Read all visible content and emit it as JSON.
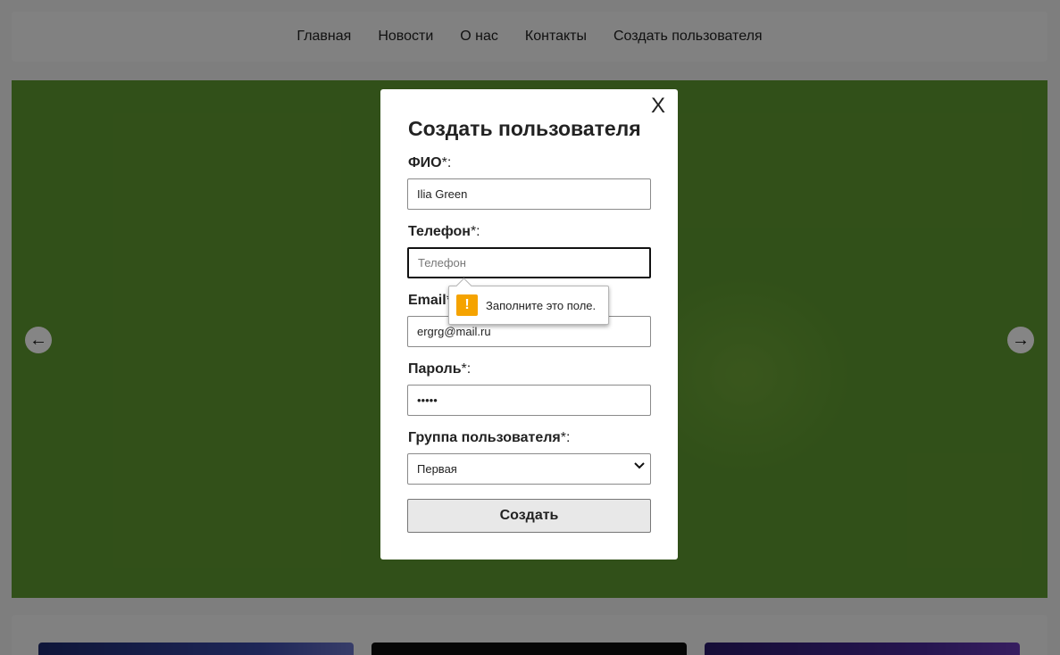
{
  "nav": {
    "items": [
      {
        "label": "Главная"
      },
      {
        "label": "Новости"
      },
      {
        "label": "О нас"
      },
      {
        "label": "Контакты"
      },
      {
        "label": "Создать пользователя"
      }
    ]
  },
  "slider": {
    "prev_arrow": "←",
    "next_arrow": "→"
  },
  "modal": {
    "close_label": "X",
    "title": "Создать пользователя",
    "fields": {
      "name": {
        "label": "ФИО",
        "required": "*:",
        "value": "Ilia Green"
      },
      "phone": {
        "label": "Телефон",
        "required": "*:",
        "value": "",
        "placeholder": "Телефон"
      },
      "email": {
        "label": "Email",
        "required": "*:",
        "value": "ergrg@mail.ru"
      },
      "password": {
        "label": "Пароль",
        "required": "*:",
        "value": "•••••"
      },
      "group": {
        "label": "Группа пользователя",
        "required": "*:",
        "selected": "Первая"
      }
    },
    "submit_label": "Создать"
  },
  "validation_tooltip": {
    "icon": "!",
    "message": "Заполните это поле."
  },
  "colors": {
    "slide_background": "#5f9a30",
    "warning": "#f5a300"
  }
}
